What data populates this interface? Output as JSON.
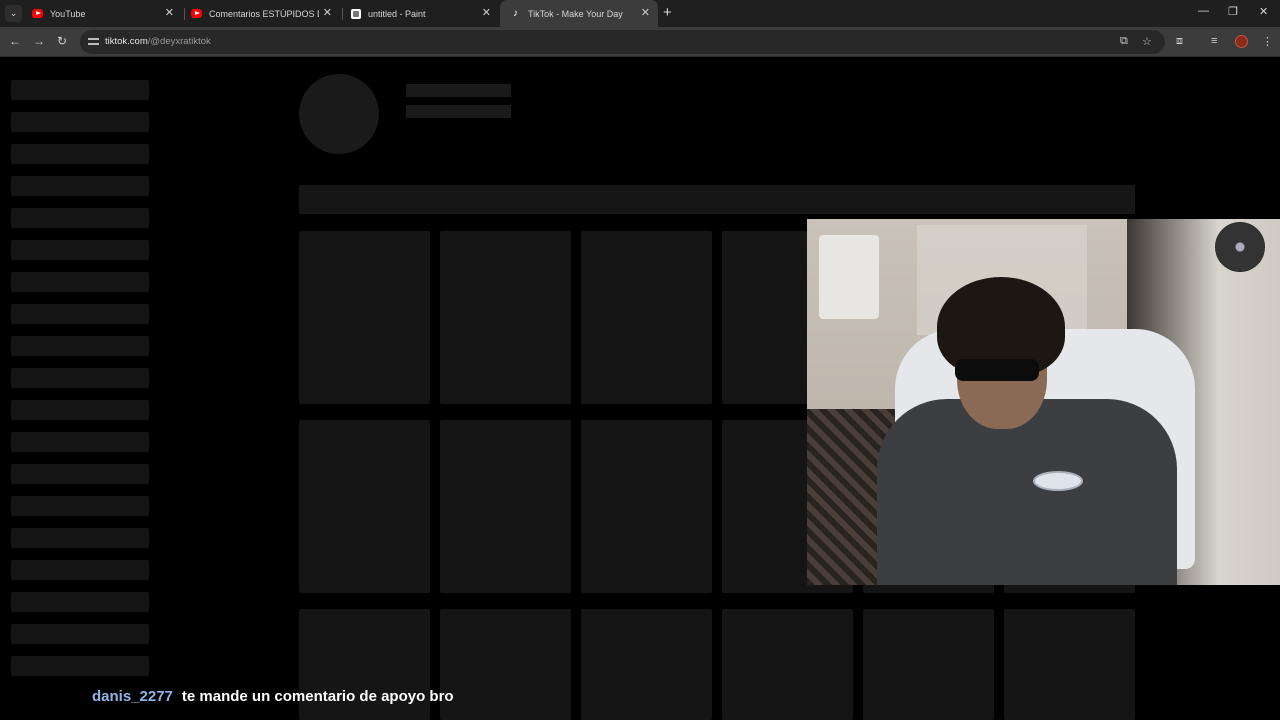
{
  "browser": {
    "tabs": [
      {
        "title": "YouTube",
        "icon": "youtube-icon",
        "active": false
      },
      {
        "title": "Comentarios ESTÚPIDOS De Tik",
        "icon": "youtube-icon",
        "active": false
      },
      {
        "title": "untitled - Paint",
        "icon": "paint-icon",
        "active": false
      },
      {
        "title": "TikTok - Make Your Day",
        "icon": "tiktok-icon",
        "active": true
      }
    ],
    "tab_close_glyph": "✕",
    "new_tab_glyph": "+",
    "tab_search_glyph": "⌄",
    "window_controls": {
      "minimize": "—",
      "restore": "❐",
      "close": "✕"
    },
    "nav": {
      "back": "←",
      "forward": "→",
      "reload": "↻"
    },
    "url": {
      "host": "tiktok.com",
      "path": "/@deyxratiktok"
    },
    "toolbar_icons": {
      "install": "⧉",
      "bookmark": "☆",
      "extensions": "⧈",
      "media": "≡",
      "menu": "⋮"
    }
  },
  "chat": {
    "username": "danis_2277",
    "message": "te mande un comentario de apoyo bro"
  },
  "colors": {
    "username": "#8fb4e6",
    "page_bg": "#000000",
    "skeleton": "#1a1a1a"
  }
}
